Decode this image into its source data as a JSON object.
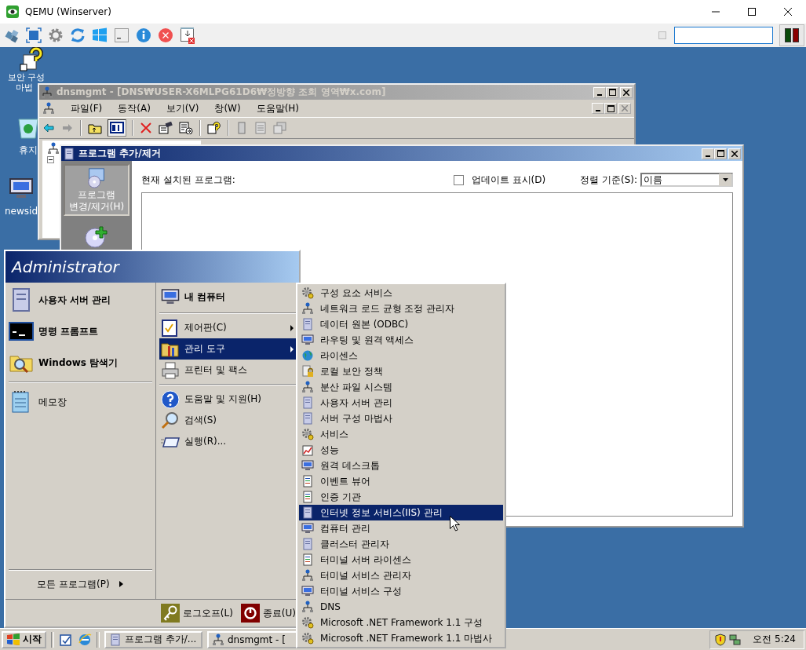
{
  "host_window": {
    "title": "QEMU (Winserver)"
  },
  "desktop_icons": [
    {
      "lines": [
        "보안 구성",
        "마법"
      ]
    },
    {
      "lines": [
        "휴지"
      ]
    },
    {
      "lines": [
        "newsid"
      ]
    }
  ],
  "dns_window": {
    "title": "dnsmgmt - [DNS₩USER-X6MLPG61D6₩정방향 조회 영역₩x.com]",
    "active": false,
    "menu": [
      "파일(F)",
      "동작(A)",
      "보기(V)",
      "창(W)",
      "도움말(H)"
    ]
  },
  "programs_window": {
    "title": "프로그램 추가/제거",
    "active": true,
    "sidebar": [
      {
        "label": "프로그램 변경/제거(H)",
        "selected": true
      }
    ],
    "installed_label": "현재 설치된 프로그램:",
    "show_updates": {
      "label": "업데이트 표시(D)",
      "checked": false
    },
    "sort": {
      "label": "정렬 기준(S):",
      "value": "이름"
    }
  },
  "start_menu": {
    "user": "Administrator",
    "pinned": [
      {
        "label": "사용자 서버 관리"
      },
      {
        "label": "명령 프롬프트"
      },
      {
        "label": "Windows 탐색기"
      }
    ],
    "recent": [
      {
        "label": "메모장"
      }
    ],
    "all_programs": "모든 프로그램(P)",
    "right_groups": [
      [
        {
          "label": "내 컴퓨터",
          "submenu": false,
          "selected": false
        }
      ],
      [
        {
          "label": "제어판(C)",
          "submenu": true,
          "selected": false
        },
        {
          "label": "관리 도구",
          "submenu": true,
          "selected": true
        },
        {
          "label": "프린터 및 팩스",
          "submenu": false,
          "selected": false
        }
      ],
      [
        {
          "label": "도움말 및 지원(H)",
          "submenu": false,
          "selected": false
        },
        {
          "label": "검색(S)",
          "submenu": false,
          "selected": false
        },
        {
          "label": "실행(R)...",
          "submenu": false,
          "selected": false
        }
      ]
    ],
    "logoff": "로그오프(L)",
    "shutdown": "종료(U)"
  },
  "admin_tools_menu": [
    {
      "label": "구성 요소 서비스",
      "selected": false
    },
    {
      "label": "네트워크 로드 균형 조정 관리자",
      "selected": false
    },
    {
      "label": "데이터 원본 (ODBC)",
      "selected": false
    },
    {
      "label": "라우팅 및 원격 액세스",
      "selected": false
    },
    {
      "label": "라이센스",
      "selected": false
    },
    {
      "label": "로컬 보안 정책",
      "selected": false
    },
    {
      "label": "분산 파일 시스템",
      "selected": false
    },
    {
      "label": "사용자 서버 관리",
      "selected": false
    },
    {
      "label": "서버 구성 마법사",
      "selected": false
    },
    {
      "label": "서비스",
      "selected": false
    },
    {
      "label": "성능",
      "selected": false
    },
    {
      "label": "원격 데스크톱",
      "selected": false
    },
    {
      "label": "이벤트 뷰어",
      "selected": false
    },
    {
      "label": "인증 기관",
      "selected": false
    },
    {
      "label": "인터넷 정보 서비스(IIS) 관리",
      "selected": true
    },
    {
      "label": "컴퓨터 관리",
      "selected": false
    },
    {
      "label": "클러스터 관리자",
      "selected": false
    },
    {
      "label": "터미널 서버 라이센스",
      "selected": false
    },
    {
      "label": "터미널 서비스 관리자",
      "selected": false
    },
    {
      "label": "터미널 서비스 구성",
      "selected": false
    },
    {
      "label": "DNS",
      "selected": false
    },
    {
      "label": "Microsoft .NET Framework 1.1 구성",
      "selected": false
    },
    {
      "label": "Microsoft .NET Framework 1.1 마법사",
      "selected": false
    }
  ],
  "taskbar": {
    "start": "시작",
    "tasks": [
      {
        "label": "프로그램 추가/...",
        "selected": false
      },
      {
        "label": "dnsmgmt - [",
        "selected": false
      }
    ],
    "clock": "오전 5:24"
  }
}
